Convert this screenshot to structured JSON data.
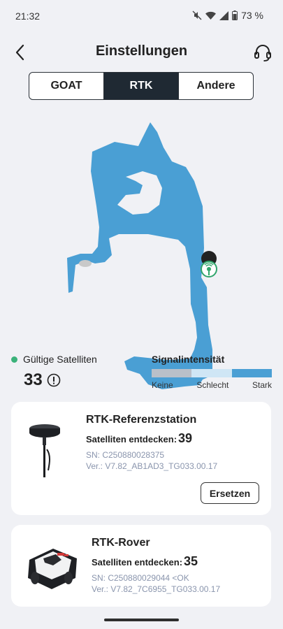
{
  "status_bar": {
    "time": "21:32",
    "battery": "73 %"
  },
  "header": {
    "title": "Einstellungen"
  },
  "tabs": [
    {
      "label": "GOAT",
      "active": false
    },
    {
      "label": "RTK",
      "active": true
    },
    {
      "label": "Andere",
      "active": false
    }
  ],
  "map": {
    "area_color": "#4a9fd4",
    "marker_color": "#2fa56b"
  },
  "satellites": {
    "label": "Gültige Satelliten",
    "count": "33",
    "status_color": "#3bb27a"
  },
  "signal": {
    "label": "Signalintensität",
    "levels": [
      "Keine",
      "Schlecht",
      "Stark"
    ],
    "level_colors": [
      "#b9c0c9",
      "#cfe6f5",
      "#4a9fd4"
    ]
  },
  "reference_station": {
    "name": "RTK-Referenzstation",
    "satellites_label": "Satelliten entdecken:",
    "satellites_count": "39",
    "sn": "SN: C250880028375",
    "version": "Ver.: V7.82_AB1AD3_TG033.00.17",
    "replace_label": "Ersetzen"
  },
  "rover": {
    "name": "RTK-Rover",
    "satellites_label": "Satelliten entdecken:",
    "satellites_count": "35",
    "sn": "SN: C250880029044 <OK",
    "version": "Ver.: V7.82_7C6955_TG033.00.17"
  }
}
